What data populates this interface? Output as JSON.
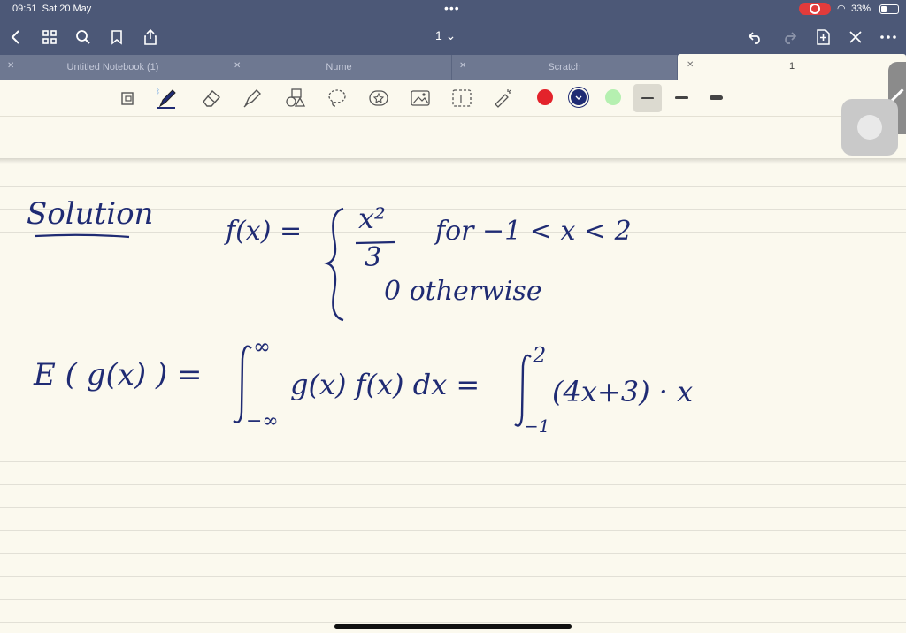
{
  "status_bar": {
    "time": "09:51",
    "date": "Sat 20 May",
    "battery_percent": "33%"
  },
  "nav": {
    "page_selector": "1 ⌄"
  },
  "tabs": [
    {
      "label": "Untitled Notebook (1)",
      "active": false
    },
    {
      "label": "Nume",
      "active": false
    },
    {
      "label": "Scratch",
      "active": false
    },
    {
      "label": "1",
      "active": true
    }
  ],
  "toolbar": {
    "tools": [
      "lasso-page-icon",
      "pen-icon",
      "eraser-icon",
      "highlighter-icon",
      "shapes-icon",
      "lasso-icon",
      "sticker-icon",
      "image-icon",
      "text-icon",
      "laser-pointer-icon"
    ],
    "colors": {
      "red": "#e3232b",
      "navy": "#1f2b73",
      "green": "#b5f0b0"
    },
    "selected_color": "navy"
  },
  "note": {
    "solution_label": "Solution",
    "fx": "f(x) =",
    "case1_num": "x²",
    "case1_den": "3",
    "case1_cond": "for  −1 < x < 2",
    "case2": "0  otherwise",
    "eq_lhs": "E ( g(x) )  =",
    "int_upper": "∞",
    "int_lower": "−∞",
    "int_body": "g(x)  f(x)  dx  =",
    "int2_upper": "2",
    "int2_lower": "−1",
    "int2_body": "(4x+3) · x"
  },
  "theme": {
    "ink": "#1f2b73",
    "paper": "#fbf9ee",
    "topbar": "#4c5877"
  }
}
